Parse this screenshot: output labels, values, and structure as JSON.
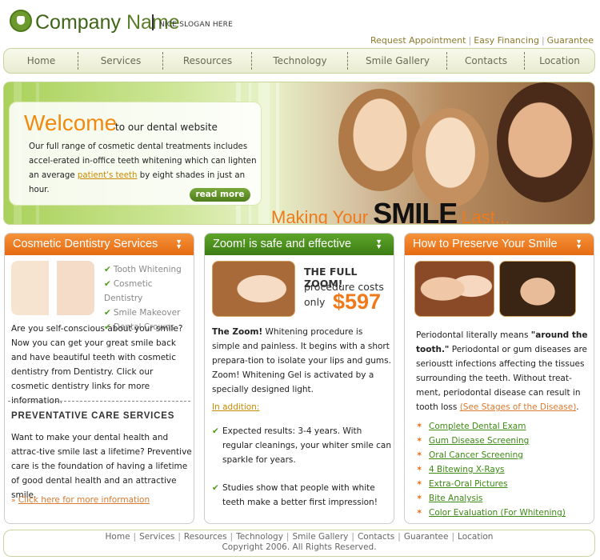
{
  "header": {
    "company_first": "Company",
    "company_second": "Name",
    "slogan": "NICE SLOGAN HERE"
  },
  "top_links": [
    "Request Appointment",
    "Easy Financing",
    "Guarantee"
  ],
  "nav": [
    "Home",
    "Services",
    "Resources",
    "Technology",
    "Smile Gallery",
    "Contacts",
    "Location"
  ],
  "banner": {
    "welcome_title": "Welcome",
    "welcome_sub": "to our dental website",
    "welcome_text_pre": "Our full range of cosmetic dental treatments includes accel-erated in-office teeth whitening which can lighten an average ",
    "welcome_link": "patient's teeth",
    "welcome_text_post": " by eight shades in just an hour.",
    "read_more": "read more",
    "tagline_pre": "Making Your ",
    "tagline_big": "SMILE",
    "tagline_post": " Last..."
  },
  "col1": {
    "title": "Cosmetic Dentistry Services",
    "checklist": [
      "Tooth Whitening",
      "Cosmetic Dentistry",
      "Smile Makeover",
      "Dental Crowns"
    ],
    "text": "Are you self-conscious about your smile? Now you can get your great smile back and have beautiful teeth with cosmetic dentistry from Dentistry. Click our cosmetic dentistry links for more information.",
    "prev_title": "PREVENTATIVE CARE SERVICES",
    "prev_text": "Want to make your dental health and attrac-tive smile last a lifetime? Preventive care is the foundation of having a lifetime of good dental health and an attractive smile.",
    "link": "Click here for more information"
  },
  "col2": {
    "title": "Zoom! is safe and effective",
    "head1": "THE FULL ZOOM!",
    "head2": "procedure costs",
    "only": "only",
    "price": "$597",
    "text_bold": "The Zoom!",
    "text": " Whitening procedure is simple and painless. It begins with a short prepara-tion to isolate your lips and gums. Zoom! Whitening Gel is activated by a specially designed light.",
    "addition": "In addition:",
    "check1": "Expected results: 3-4 years. With regular cleanings, your whiter smile can sparkle for years.",
    "check2": "Studies show that people with white teeth make a better first impression!"
  },
  "col3": {
    "title": "How to Preserve Your Smile",
    "text_pre": "Periodontal literally means ",
    "text_bold": "\"around the tooth.\"",
    "text_mid": " Periodontal or gum diseases are serioustt infections affecting the tissues surrounding the teeth. Without treat-ment, periodontal disease can result in tooth loss ",
    "text_link": "(See Stages of the Disease)",
    "text_end": ".",
    "items": [
      "Complete Dental Exam",
      "Gum Disease Screening",
      "Oral Cancer Screening",
      "4 Bitewing X-Rays",
      "Extra-Oral Pictures",
      "Bite Analysis",
      "Color Evaluation (For Whitening)"
    ]
  },
  "footer": {
    "links": [
      "Home",
      "Services",
      "Resources",
      "Technology",
      "Smile Gallery",
      "Contacts",
      "Guarantee",
      "Location"
    ],
    "copyright": "Copyright 2006. All Rights Reserved."
  },
  "colors": {
    "accent_orange": "#e56b12",
    "accent_green": "#3c7d14",
    "brand_green": "#5a7d28"
  }
}
